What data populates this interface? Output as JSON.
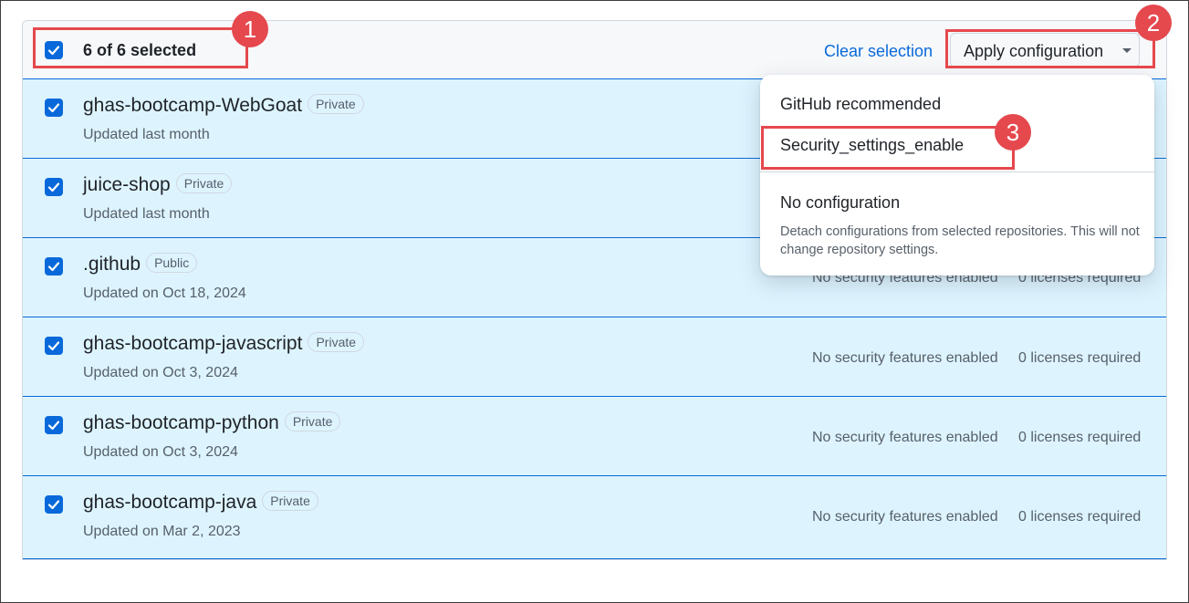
{
  "header": {
    "selection_text": "6 of 6 selected",
    "clear_selection": "Clear selection",
    "apply_configuration": "Apply configuration"
  },
  "repos": [
    {
      "name": "ghas-bootcamp-WebGoat",
      "visibility": "Private",
      "updated": "Updated last month",
      "features": "",
      "licenses": ""
    },
    {
      "name": "juice-shop",
      "visibility": "Private",
      "updated": "Updated last month",
      "features": "",
      "licenses": ""
    },
    {
      "name": ".github",
      "visibility": "Public",
      "updated": "Updated on Oct 18, 2024",
      "features": "No security features enabled",
      "licenses": "0 licenses required"
    },
    {
      "name": "ghas-bootcamp-javascript",
      "visibility": "Private",
      "updated": "Updated on Oct 3, 2024",
      "features": "No security features enabled",
      "licenses": "0 licenses required"
    },
    {
      "name": "ghas-bootcamp-python",
      "visibility": "Private",
      "updated": "Updated on Oct 3, 2024",
      "features": "No security features enabled",
      "licenses": "0 licenses required"
    },
    {
      "name": "ghas-bootcamp-java",
      "visibility": "Private",
      "updated": "Updated on Mar 2, 2023",
      "features": "No security features enabled",
      "licenses": "0 licenses required"
    }
  ],
  "menu": {
    "github_recommended": "GitHub recommended",
    "security_settings_enable": "Security_settings_enable",
    "no_configuration": "No configuration",
    "no_configuration_desc": "Detach configurations from selected repositories. This will not change repository settings."
  },
  "callouts": [
    "1",
    "2",
    "3"
  ],
  "colors": {
    "accent": "#0969da",
    "row_selected": "#ddf4ff",
    "annotation": "#e5484d"
  }
}
